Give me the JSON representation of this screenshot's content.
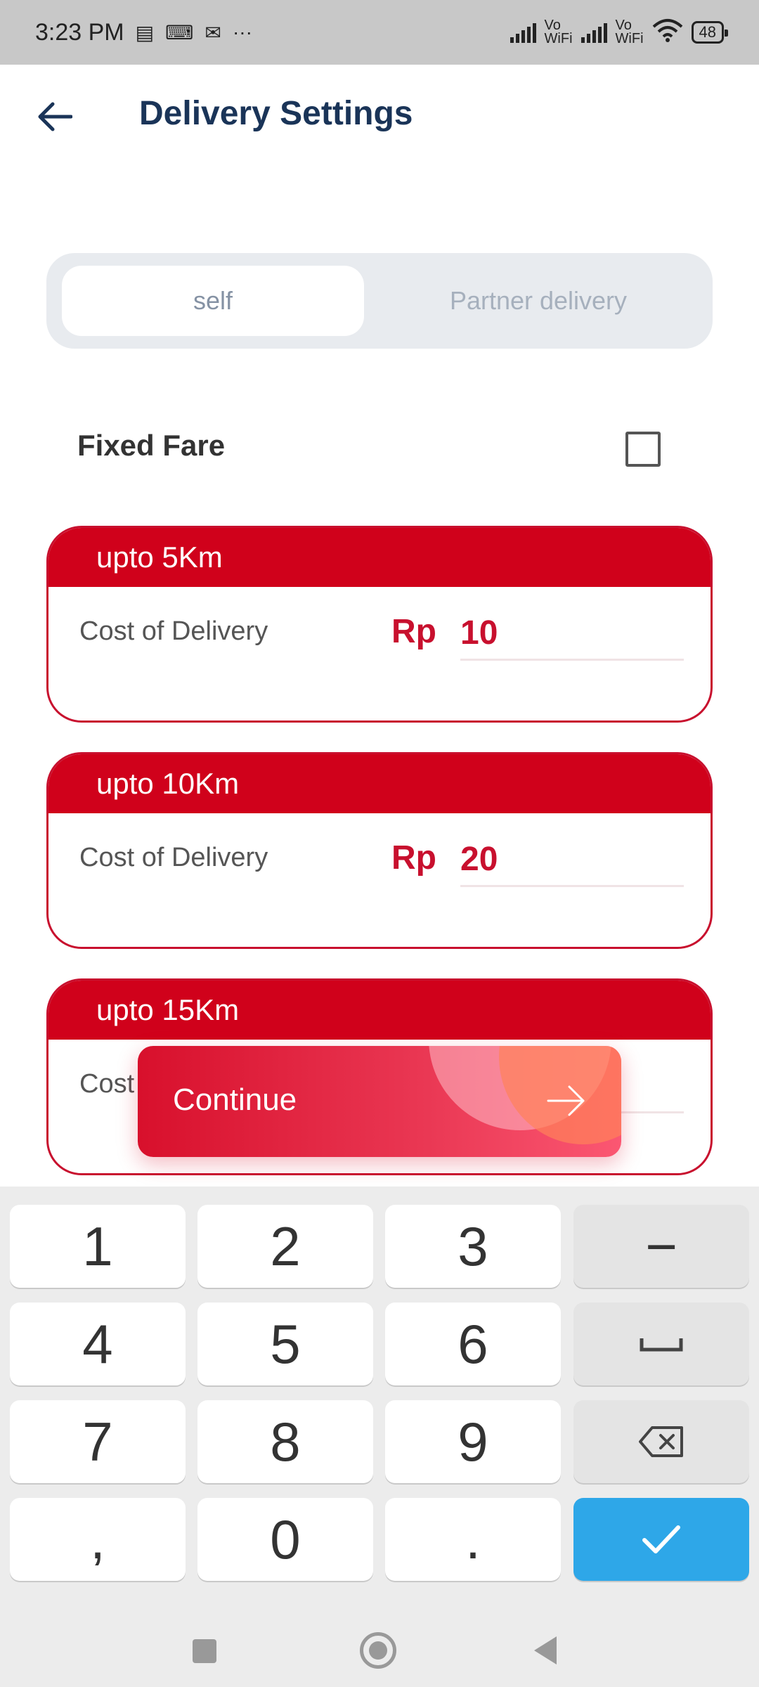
{
  "status_bar": {
    "time": "3:23 PM",
    "vowifi_top": "Vo",
    "vowifi_bottom": "WiFi",
    "battery": "48",
    "more": "···"
  },
  "header": {
    "title": "Delivery Settings"
  },
  "toggle": {
    "options": [
      "self",
      "Partner delivery"
    ],
    "selected": "self"
  },
  "fixed_fare": {
    "label": "Fixed Fare",
    "checked": false
  },
  "cards": [
    {
      "title": "upto 5Km",
      "label": "Cost of Delivery",
      "currency": "Rp",
      "value": "10"
    },
    {
      "title": "upto 10Km",
      "label": "Cost of Delivery",
      "currency": "Rp",
      "value": "20"
    },
    {
      "title": "upto 15Km",
      "label": "Cost",
      "currency": "",
      "value": ""
    }
  ],
  "continue_button": {
    "label": "Continue"
  },
  "keyboard": {
    "rows": [
      [
        "1",
        "2",
        "3",
        "−"
      ],
      [
        "4",
        "5",
        "6",
        "space"
      ],
      [
        "7",
        "8",
        "9",
        "backspace"
      ],
      [
        ",",
        "0",
        ".",
        "done"
      ]
    ]
  },
  "colors": {
    "accent_red": "#d0011b",
    "title_navy": "#1a3458",
    "keyboard_done_blue": "#2ea7e8"
  }
}
